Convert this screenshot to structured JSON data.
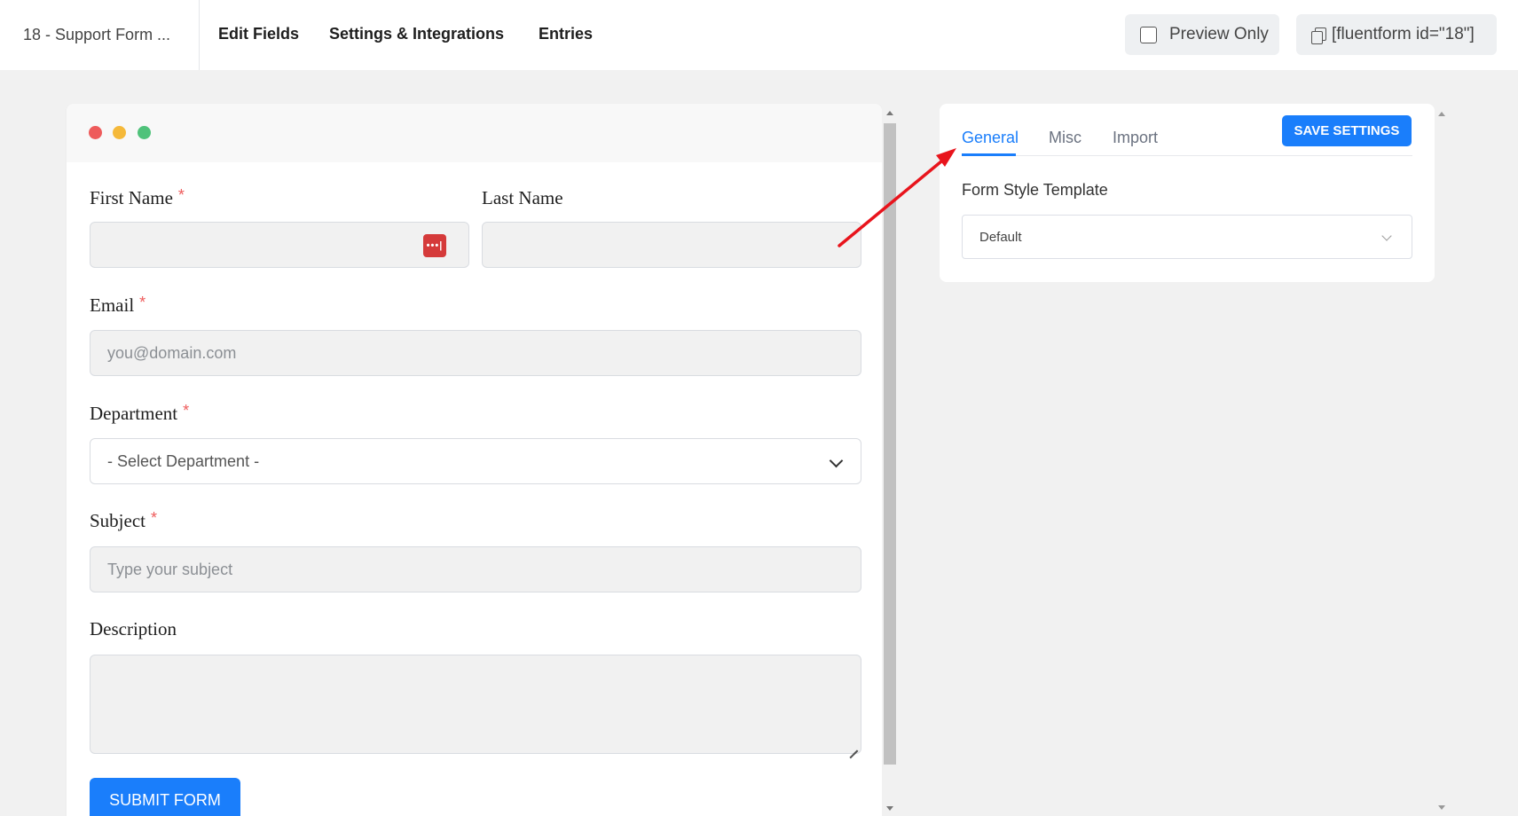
{
  "header": {
    "form_title": "18 - Support Form ...",
    "nav": [
      "Edit Fields",
      "Settings & Integrations",
      "Entries"
    ],
    "preview_label": "Preview Only",
    "shortcode": "[fluentform id=\"18\"]"
  },
  "form": {
    "first_name": {
      "label": "First Name",
      "required": "*"
    },
    "last_name": {
      "label": "Last Name"
    },
    "email": {
      "label": "Email",
      "required": "*",
      "placeholder": "you@domain.com"
    },
    "department": {
      "label": "Department",
      "required": "*",
      "selected": "- Select Department -"
    },
    "subject": {
      "label": "Subject",
      "required": "*",
      "placeholder": "Type your subject"
    },
    "description": {
      "label": "Description"
    },
    "submit_label": "SUBMIT FORM",
    "password_manager_icon": "•••|"
  },
  "settings": {
    "tabs": [
      "General",
      "Misc",
      "Import"
    ],
    "save_label": "SAVE SETTINGS",
    "style_template_label": "Form Style Template",
    "style_template_value": "Default"
  },
  "colors": {
    "accent": "#1a7efb",
    "required": "#ee5b5b",
    "annotation_arrow": "#e8141c"
  }
}
